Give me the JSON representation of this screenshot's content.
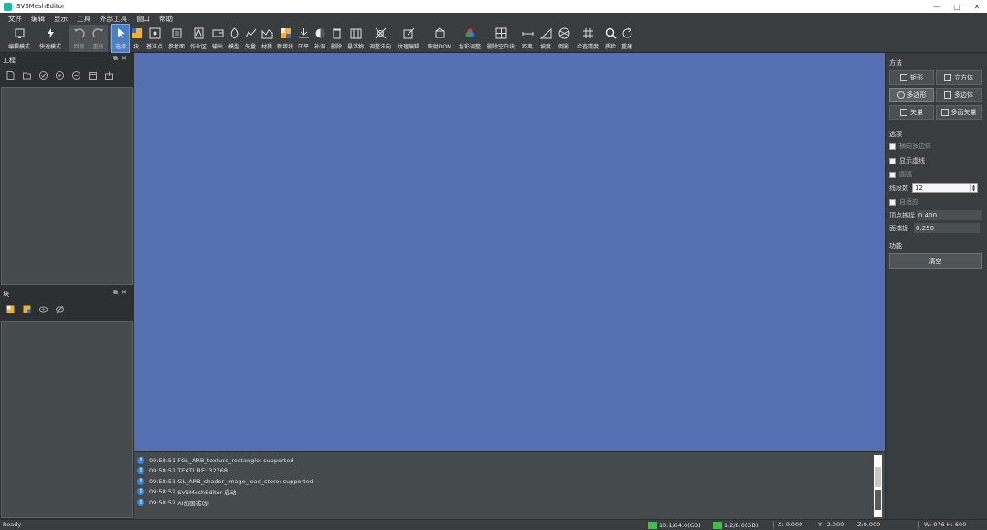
{
  "window": {
    "title": "SVSMeshEditor",
    "minimize": "—",
    "maximize": "▢",
    "close": "✕"
  },
  "menu": [
    "文件",
    "编辑",
    "显示",
    "工具",
    "外部工具",
    "窗口",
    "帮助"
  ],
  "toolbar": [
    {
      "label": "编辑模式",
      "icon": "edit-mode-icon"
    },
    {
      "label": "快速模式",
      "icon": "lightning-icon"
    },
    {
      "label": "回撤",
      "icon": "undo-icon"
    },
    {
      "label": "重做",
      "icon": "redo-icon"
    },
    {
      "label": "选择",
      "icon": "cursor-icon"
    },
    {
      "label": "块",
      "icon": "block-icon"
    },
    {
      "label": "基准点",
      "icon": "datum-point-icon"
    },
    {
      "label": "参考面",
      "icon": "reference-plane-icon"
    },
    {
      "label": "作业区",
      "icon": "work-area-icon"
    },
    {
      "label": "输出",
      "icon": "output-icon"
    },
    {
      "label": "模型",
      "icon": "model-icon"
    },
    {
      "label": "矢量",
      "icon": "vector-icon"
    },
    {
      "label": "材质",
      "icon": "material-icon"
    },
    {
      "label": "新增块",
      "icon": "add-block-icon"
    },
    {
      "label": "压平",
      "icon": "flatten-icon"
    },
    {
      "label": "补洞",
      "icon": "fill-hole-icon"
    },
    {
      "label": "删除",
      "icon": "delete-icon"
    },
    {
      "label": "悬浮物",
      "icon": "floating-object-icon"
    },
    {
      "label": "调整法向",
      "icon": "normal-adjust-icon"
    },
    {
      "label": "纹理编辑",
      "icon": "texture-edit-icon"
    },
    {
      "label": "映射DOM",
      "icon": "map-dom-icon"
    },
    {
      "label": "色彩调整",
      "icon": "color-adjust-icon"
    },
    {
      "label": "删除空白块",
      "icon": "delete-empty-block-icon"
    },
    {
      "label": "距离",
      "icon": "distance-icon"
    },
    {
      "label": "坡度",
      "icon": "slope-icon"
    },
    {
      "label": "倒影",
      "icon": "reflection-icon"
    },
    {
      "label": "检查精度",
      "icon": "check-precision-icon"
    },
    {
      "label": "质检",
      "icon": "inspect-icon"
    },
    {
      "label": "重建",
      "icon": "rebuild-icon"
    }
  ],
  "project_panel": {
    "title": "工程",
    "float": "⧉",
    "close": "✕"
  },
  "block_panel": {
    "title": "块",
    "float": "⧉",
    "close": "✕"
  },
  "log": [
    {
      "time": "09:58:51",
      "text": "FGL_ARB_texture_rectangle: supported"
    },
    {
      "time": "09:58:51",
      "text": "TEXTURE: 32768"
    },
    {
      "time": "09:58:51",
      "text": "GL_ARB_shader_image_load_store: supported"
    },
    {
      "time": "09:58:52",
      "text": "SVSMeshEditor 启动"
    },
    {
      "time": "09:58:52",
      "text": "AI加固成功!"
    }
  ],
  "right_panel": {
    "method_title": "方法",
    "methods": [
      "矩形",
      "立方体",
      "多边形",
      "多边体",
      "矢量",
      "多面矢量"
    ],
    "options_title": "选项",
    "opt_hpoly": "横向多边体",
    "opt_show_dashed": "显示虚线",
    "opt_circle": "圆弧",
    "segments_label": "线段数",
    "segments_value": "12",
    "opt_adaptive": "自适应",
    "vertex_snap_label": "顶点捕捉",
    "vertex_snap_value": "0.400",
    "face_snap_label": "面捕捉",
    "face_snap_value": "0.250",
    "function_title": "功能",
    "clear_label": "清空"
  },
  "status": {
    "ready": "Ready",
    "mem1": "10.1/64.0(GB)",
    "mem2": "1.2/8.0(GB)",
    "x": "X: 0.000",
    "y": "Y: -2.000",
    "z": "Z:0.000",
    "size": "W: 976  H: 600"
  },
  "colors": {
    "viewport": "#5570b2",
    "active_tool": "#4d7fc4",
    "memory_bar": "#3bc14a",
    "info_icon": "#3a86d8"
  }
}
